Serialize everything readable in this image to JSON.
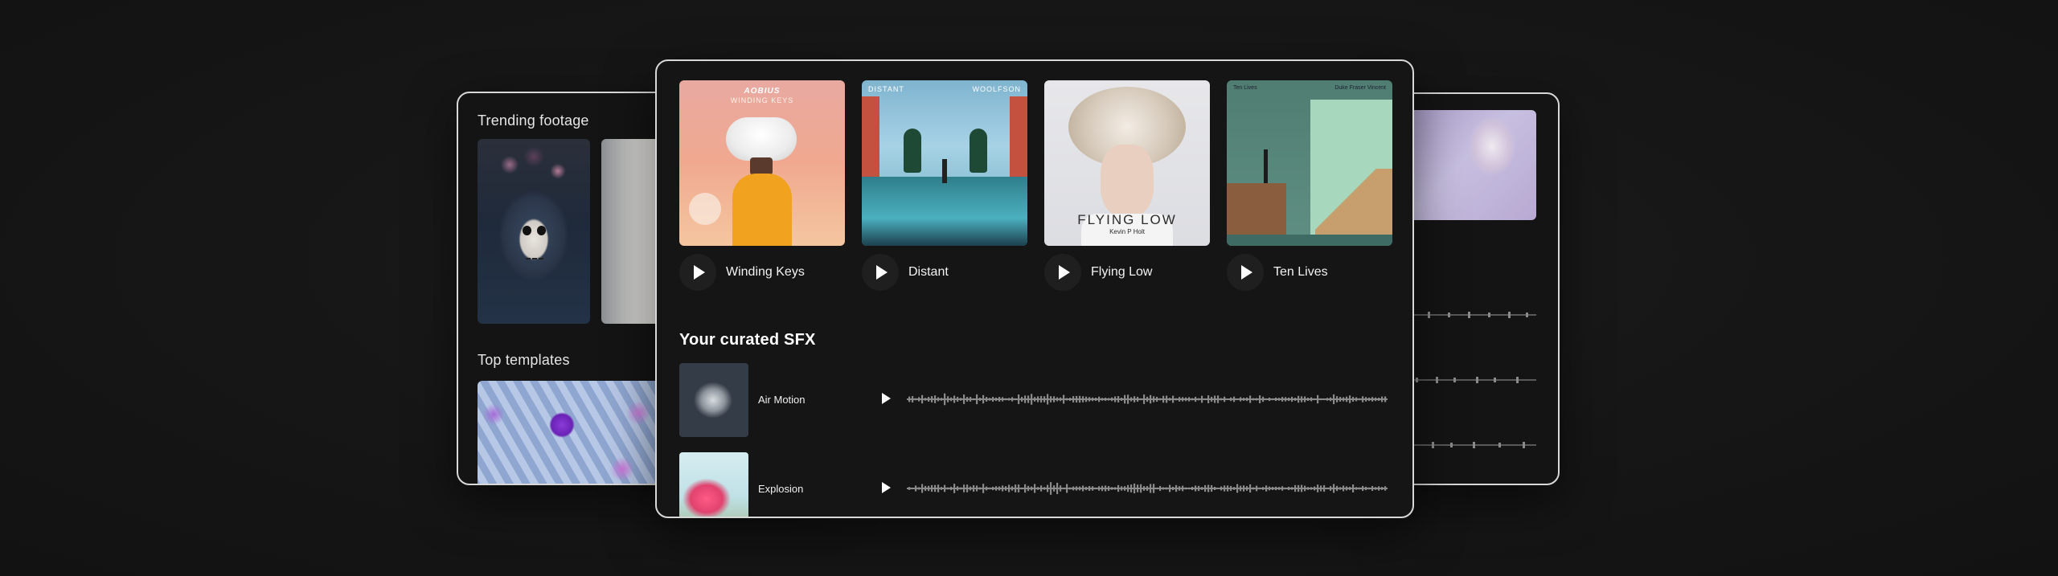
{
  "left_panel": {
    "trending_title": "Trending footage",
    "templates_title": "Top templates"
  },
  "main_panel": {
    "albums": [
      {
        "name": "Winding Keys",
        "cover_brand": "AOBIUS",
        "cover_title": "WINDING KEYS"
      },
      {
        "name": "Distant",
        "cover_left": "DISTANT",
        "cover_right": "WOOLFSON"
      },
      {
        "name": "Flying Low",
        "cover_title": "FLYING LOW",
        "cover_artist": "Kevin P Holt"
      },
      {
        "name": "Ten Lives",
        "cover_left": "Ten Lives",
        "cover_right": "Duke Fraser Vincent"
      }
    ],
    "sfx_title": "Your curated SFX",
    "sfx": [
      {
        "name": "Air Motion"
      },
      {
        "name": "Explosion"
      }
    ]
  },
  "colors": {
    "background": "#161616",
    "panel": "#151515",
    "border": "#d8d8d8",
    "waveform": "#8a8a8a"
  },
  "icons": [
    "play-icon"
  ]
}
